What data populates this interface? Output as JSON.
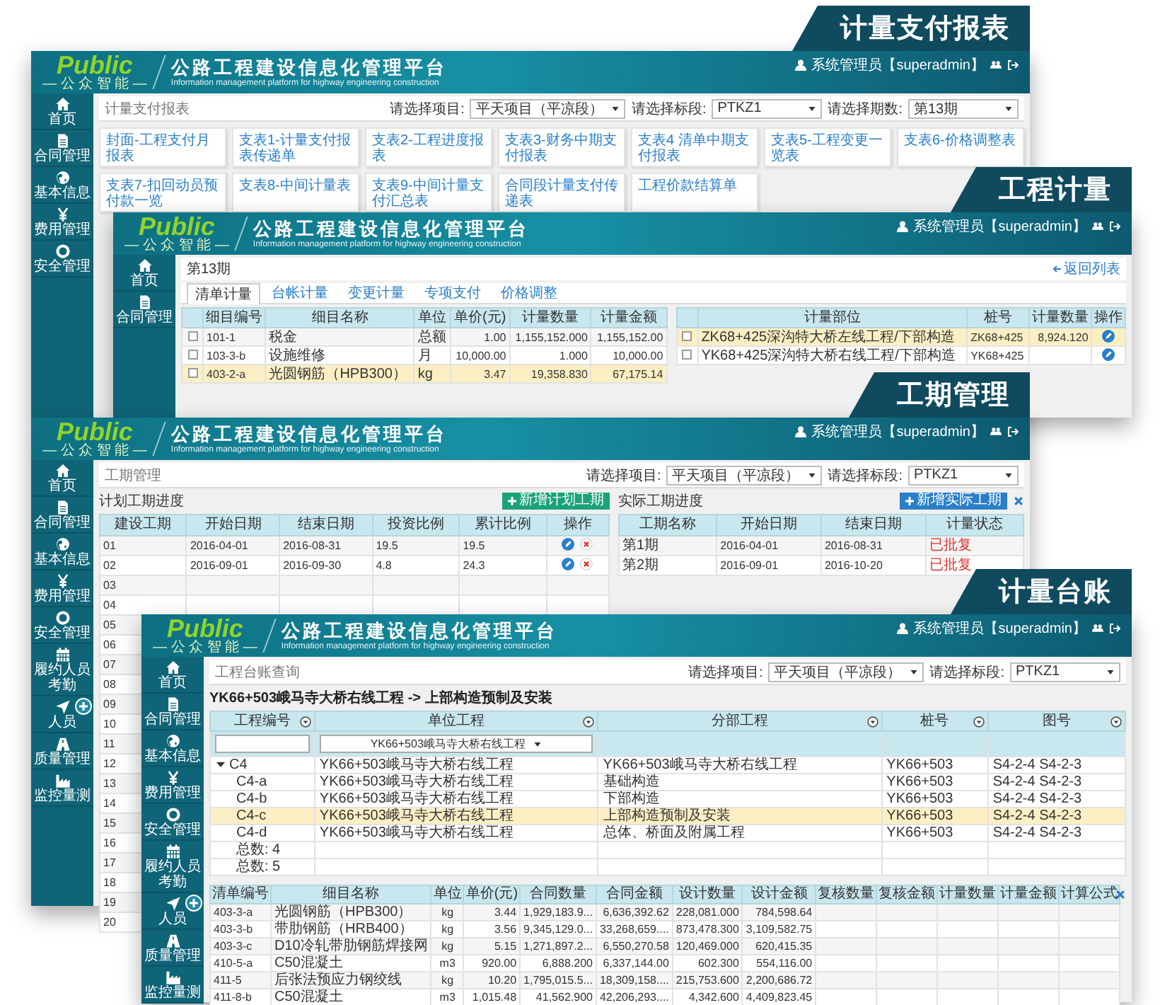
{
  "windows": [
    {
      "kind": "reports",
      "tag": "计量支付报表",
      "brand": {
        "logo": "Public",
        "slogan": "— 公 众 智 能 —",
        "title": "公路工程建设信息化管理平台",
        "subtitle": "Information management platform for highway engineering construction"
      },
      "user": "系统管理员【superadmin】",
      "sidebar": [
        {
          "label": "首页",
          "add_button": false
        },
        {
          "label": "合同管理",
          "add_button": false
        },
        {
          "label": "基本信息",
          "add_button": false
        },
        {
          "label": "费用管理",
          "add_button": false
        },
        {
          "label": "安全管理",
          "add_button": false
        }
      ],
      "breadcrumb": "计量支付报表",
      "filters": [
        {
          "label": "请选择项目:",
          "value": "平天项目（平凉段）"
        },
        {
          "label": "请选择标段:",
          "value": "PTKZ1"
        },
        {
          "label": "请选择期数:",
          "value": "第13期"
        }
      ],
      "reports": [
        "封面-工程支付月报表",
        "支表1-计量支付报表传递单",
        "支表2-工程进度报表",
        "支表3-财务中期支付报表",
        "支表4 清单中期支付报表",
        "支表5-工程变更一览表",
        "支表6-价格调整表",
        "支表7-扣回动员预付款一览",
        "支表8-中间计量表",
        "支表9-中间计量支付汇总表",
        "合同段计量支付传递表",
        "工程价款结算单"
      ]
    },
    {
      "kind": "measure",
      "tag": "工程计量",
      "brand": {
        "logo": "Public",
        "slogan": "— 公 众 智 能 —",
        "title": "公路工程建设信息化管理平台",
        "subtitle": "Information management platform for highway engineering construction"
      },
      "user": "系统管理员【superadmin】",
      "sidebar": [
        {
          "label": "首页",
          "add_button": false
        },
        {
          "label": "合同管理",
          "add_button": false
        }
      ],
      "period": "第13期",
      "back_link": "返回列表",
      "tabs": [
        {
          "label": "清单计量",
          "selected": true
        },
        {
          "label": "台帐计量",
          "selected": false
        },
        {
          "label": "变更计量",
          "selected": false
        },
        {
          "label": "专项支付",
          "selected": false
        },
        {
          "label": "价格调整",
          "selected": false
        }
      ],
      "left_table": {
        "row_checkboxes": true,
        "columns": [
          {
            "label": "细目编号",
            "kind": "code"
          },
          {
            "label": "细目名称",
            "kind": "text"
          },
          {
            "label": "单位",
            "kind": "text"
          },
          {
            "label": "单价(元)",
            "kind": "num"
          },
          {
            "label": "计量数量",
            "kind": "num"
          },
          {
            "label": "计量金额",
            "kind": "num"
          }
        ],
        "rows": [
          {
            "checked": false,
            "selected": false,
            "cells": [
              "101-1",
              "税金",
              "总额",
              "1.00",
              "1,155,152.000",
              "1,155,152.00"
            ]
          },
          {
            "checked": false,
            "selected": false,
            "cells": [
              "103-3-b",
              "设施维修",
              "月",
              "10,000.00",
              "1.000",
              "10,000.00"
            ]
          },
          {
            "checked": false,
            "selected": true,
            "cells": [
              "403-2-a",
              "光圆钢筋（HPB300）",
              "kg",
              "3.47",
              "19,358.830",
              "67,175.14"
            ]
          }
        ]
      },
      "right_table": {
        "row_checkboxes": true,
        "columns": [
          {
            "label": "计量部位",
            "kind": "text"
          },
          {
            "label": "桩号",
            "kind": "code"
          },
          {
            "label": "计量数量",
            "kind": "num"
          },
          {
            "label": "操作",
            "kind": "actions"
          }
        ],
        "rows": [
          {
            "checked": false,
            "selected": true,
            "cells": [
              "ZK68+425深沟特大桥左线工程/下部构造",
              "ZK68+425",
              "8,924.120"
            ],
            "edit_button": true,
            "delete_button": false
          },
          {
            "checked": false,
            "selected": false,
            "cells": [
              "YK68+425深沟特大桥右线工程/下部构造",
              "YK68+425"
            ],
            "edit_button": true,
            "delete_button": false
          }
        ]
      }
    },
    {
      "kind": "schedule",
      "tag": "工期管理",
      "brand": {
        "logo": "Public",
        "slogan": "— 公 众 智 能 —",
        "title": "公路工程建设信息化管理平台",
        "subtitle": "Information management platform for highway engineering construction"
      },
      "user": "系统管理员【superadmin】",
      "sidebar": [
        {
          "label": "首页",
          "add_button": false
        },
        {
          "label": "合同管理",
          "add_button": false
        },
        {
          "label": "基本信息",
          "add_button": false
        },
        {
          "label": "费用管理",
          "add_button": false
        },
        {
          "label": "安全管理",
          "add_button": false
        },
        {
          "label": "履约人员考勤",
          "add_button": false
        },
        {
          "label": "人员",
          "add_button": true
        },
        {
          "label": "质量管理",
          "add_button": false
        },
        {
          "label": "监控量测",
          "add_button": false
        }
      ],
      "breadcrumb": "工期管理",
      "filters": [
        {
          "label": "请选择项目:",
          "value": "平天项目（平凉段）"
        },
        {
          "label": "请选择标段:",
          "value": "PTKZ1"
        }
      ],
      "panels": [
        {
          "title": "计划工期进度",
          "button": {
            "label": "新增计划工期",
            "color": "#1aa37a"
          },
          "closable": false,
          "table": {
            "columns": [
              {
                "label": "建设工期",
                "kind": "code"
              },
              {
                "label": "开始日期",
                "kind": "code"
              },
              {
                "label": "结束日期",
                "kind": "code"
              },
              {
                "label": "投资比例",
                "kind": "code"
              },
              {
                "label": "累计比例",
                "kind": "code"
              },
              {
                "label": "操作",
                "kind": "actions"
              }
            ],
            "rows": [
              {
                "selected": false,
                "cells": [
                  "01",
                  "2016-04-01",
                  "2016-08-31",
                  "19.5",
                  "19.5"
                ],
                "edit_button": true,
                "delete_button": true
              },
              {
                "selected": false,
                "cells": [
                  "02",
                  "2016-09-01",
                  "2016-09-30",
                  "4.8",
                  "24.3"
                ],
                "edit_button": true,
                "delete_button": true
              },
              {
                "selected": false,
                "cells": [
                  "03"
                ]
              },
              {
                "selected": false,
                "cells": [
                  "04"
                ]
              },
              {
                "selected": false,
                "cells": [
                  "05"
                ]
              },
              {
                "selected": false,
                "cells": [
                  "06"
                ]
              },
              {
                "selected": false,
                "cells": [
                  "07"
                ]
              },
              {
                "selected": false,
                "cells": [
                  "08"
                ]
              },
              {
                "selected": false,
                "cells": [
                  "09"
                ]
              },
              {
                "selected": false,
                "cells": [
                  "10"
                ]
              },
              {
                "selected": false,
                "cells": [
                  "11"
                ]
              },
              {
                "selected": false,
                "cells": [
                  "12"
                ]
              },
              {
                "selected": false,
                "cells": [
                  "13"
                ]
              },
              {
                "selected": false,
                "cells": [
                  "14"
                ]
              },
              {
                "selected": false,
                "cells": [
                  "15"
                ]
              },
              {
                "selected": false,
                "cells": [
                  "16"
                ]
              },
              {
                "selected": false,
                "cells": [
                  "17"
                ]
              },
              {
                "selected": false,
                "cells": [
                  "18"
                ]
              },
              {
                "selected": false,
                "cells": [
                  "19"
                ]
              },
              {
                "selected": false,
                "cells": [
                  "20"
                ]
              }
            ]
          }
        },
        {
          "title": "实际工期进度",
          "button": {
            "label": "新增实际工期",
            "color": "#2a7fc9"
          },
          "closable": true,
          "table": {
            "columns": [
              {
                "label": "工期名称",
                "kind": "text"
              },
              {
                "label": "开始日期",
                "kind": "code"
              },
              {
                "label": "结束日期",
                "kind": "code"
              },
              {
                "label": "计量状态",
                "kind": "status"
              }
            ],
            "rows": [
              {
                "selected": false,
                "cells": [
                  "第1期",
                  "2016-04-01",
                  "2016-08-31",
                  "已批复"
                ]
              },
              {
                "selected": false,
                "cells": [
                  "第2期",
                  "2016-09-01",
                  "2016-10-20",
                  "已批复"
                ]
              }
            ]
          }
        }
      ]
    },
    {
      "kind": "ledger",
      "tag": "计量台账",
      "brand": {
        "logo": "Public",
        "slogan": "— 公 众 智 能 —",
        "title": "公路工程建设信息化管理平台",
        "subtitle": "Information management platform for highway engineering construction"
      },
      "user": "系统管理员【superadmin】",
      "sidebar": [
        {
          "label": "首页",
          "add_button": false
        },
        {
          "label": "合同管理",
          "add_button": false
        },
        {
          "label": "基本信息",
          "add_button": false
        },
        {
          "label": "费用管理",
          "add_button": false
        },
        {
          "label": "安全管理",
          "add_button": false
        },
        {
          "label": "履约人员考勤",
          "add_button": false
        },
        {
          "label": "人员",
          "add_button": true
        },
        {
          "label": "质量管理",
          "add_button": false
        },
        {
          "label": "监控量测",
          "add_button": false
        }
      ],
      "breadcrumb": "工程台账查询",
      "filters": [
        {
          "label": "请选择项目:",
          "value": "平天项目（平凉段）"
        },
        {
          "label": "请选择标段:",
          "value": "PTKZ1"
        }
      ],
      "path": "YK66+503峨马寺大桥右线工程 -> 上部构造预制及安装",
      "grid": {
        "columns": [
          "工程编号",
          "单位工程",
          "分部工程",
          "桩号",
          "图号"
        ],
        "filters": [
          {
            "kind": "text"
          },
          {
            "kind": "select",
            "value": "YK66+503峨马寺大桥右线工程"
          }
        ],
        "rows": [
          {
            "cells": [
              "C4",
              "YK66+503峨马寺大桥右线工程",
              "YK66+503峨马寺大桥右线工程",
              "YK66+503",
              "S4-2-4 S4-2-3"
            ],
            "expanded": true,
            "selected": false,
            "total": "总数: 4",
            "children": [
              {
                "cells": [
                  "C4-a",
                  "YK66+503峨马寺大桥右线工程",
                  "基础构造",
                  "YK66+503",
                  "S4-2-4 S4-2-3"
                ],
                "selected": false
              },
              {
                "cells": [
                  "C4-b",
                  "YK66+503峨马寺大桥右线工程",
                  "下部构造",
                  "YK66+503",
                  "S4-2-4 S4-2-3"
                ],
                "selected": false
              },
              {
                "cells": [
                  "C4-c",
                  "YK66+503峨马寺大桥右线工程",
                  "上部构造预制及安装",
                  "YK66+503",
                  "S4-2-4 S4-2-3"
                ],
                "selected": true
              },
              {
                "cells": [
                  "C4-d",
                  "YK66+503峨马寺大桥右线工程",
                  "总体、桥面及附属工程",
                  "YK66+503",
                  "S4-2-4 S4-2-3"
                ],
                "selected": false
              }
            ]
          }
        ],
        "total": "总数: 5"
      },
      "items_table": {
        "closable": true,
        "columns": [
          {
            "label": "清单编号",
            "kind": "code"
          },
          {
            "label": "细目名称",
            "kind": "text"
          },
          {
            "label": "单位",
            "kind": "center"
          },
          {
            "label": "单价(元)",
            "kind": "num"
          },
          {
            "label": "合同数量",
            "kind": "num"
          },
          {
            "label": "合同金额",
            "kind": "num"
          },
          {
            "label": "设计数量",
            "kind": "num"
          },
          {
            "label": "设计金额",
            "kind": "num"
          },
          {
            "label": "复核数量",
            "kind": "num"
          },
          {
            "label": "复核金额",
            "kind": "num"
          },
          {
            "label": "计量数量",
            "kind": "num"
          },
          {
            "label": "计量金额",
            "kind": "num"
          },
          {
            "label": "计算公式",
            "kind": "text"
          }
        ],
        "rows": [
          {
            "selected": false,
            "cells": [
              "403-3-a",
              "光圆钢筋（HPB300）",
              "kg",
              "3.44",
              "1,929,183.9...",
              "6,636,392.62",
              "228,081.000",
              "784,598.64"
            ]
          },
          {
            "selected": false,
            "cells": [
              "403-3-b",
              "带肋钢筋（HRB400）",
              "kg",
              "3.56",
              "9,345,129.0...",
              "33,268,659....",
              "873,478.300",
              "3,109,582.75"
            ]
          },
          {
            "selected": false,
            "cells": [
              "403-3-c",
              "D10冷轧带肋钢筋焊接网",
              "kg",
              "5.15",
              "1,271,897.2...",
              "6,550,270.58",
              "120,469.000",
              "620,415.35"
            ]
          },
          {
            "selected": false,
            "cells": [
              "410-5-a",
              "C50混凝土",
              "m3",
              "920.00",
              "6,888.200",
              "6,337,144.00",
              "602.300",
              "554,116.00"
            ]
          },
          {
            "selected": false,
            "cells": [
              "411-5",
              "后张法预应力钢绞线",
              "kg",
              "10.20",
              "1,795,015.5...",
              "18,309,158....",
              "215,753.600",
              "2,200,686.72"
            ]
          },
          {
            "selected": false,
            "cells": [
              "411-8-b",
              "C50混凝土",
              "m3",
              "1,015.48",
              "41,562.900",
              "42,206,293....",
              "4,342.600",
              "4,409,823.45"
            ]
          }
        ]
      }
    }
  ]
}
